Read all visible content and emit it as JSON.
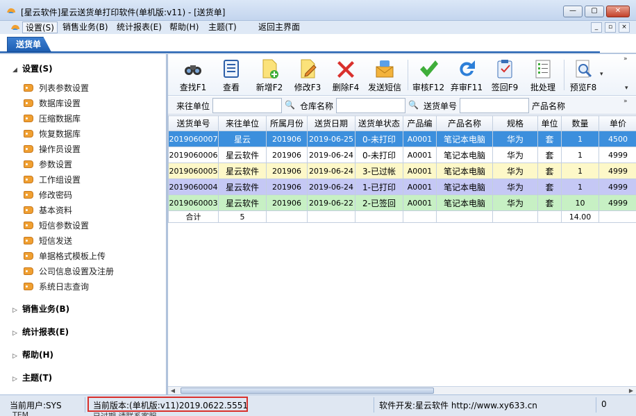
{
  "window": {
    "title": "[星云软件]星云送货单打印软件(单机版:v11) - [送货单]",
    "minimize_label": "—",
    "maximize_label": "▢",
    "close_label": "✕"
  },
  "menu": {
    "items": [
      "设置(S)",
      "销售业务(B)",
      "统计报表(E)",
      "帮助(H)",
      "主题(T)",
      "返回主界面"
    ],
    "mdi": [
      "_",
      "▫",
      "×"
    ]
  },
  "tab": {
    "label": "送货单"
  },
  "sidebar": {
    "settings_header": "设置(S)",
    "settings_items": [
      "列表参数设置",
      "数据库设置",
      "压缩数据库",
      "恢复数据库",
      "操作员设置",
      "参数设置",
      "工作组设置",
      "修改密码",
      "基本资料",
      "短信参数设置",
      "短信发送",
      "单据格式模板上传",
      "公司信息设置及注册",
      "系统日志查询"
    ],
    "sections": [
      "销售业务(B)",
      "统计报表(E)",
      "帮助(H)",
      "主题(T)"
    ]
  },
  "toolbar": {
    "buttons": [
      "查找F1",
      "查看",
      "新增F2",
      "修改F3",
      "删除F4",
      "发送短信",
      "审核F12",
      "弃审F11",
      "签回F9",
      "批处理",
      "预览F8"
    ]
  },
  "filters": {
    "customer_label": "来往单位",
    "warehouse_label": "仓库名称",
    "order_no_label": "送货单号",
    "product_label": "产品名称"
  },
  "table": {
    "columns": [
      "送货单号",
      "来往单位",
      "所属月份",
      "送货日期",
      "送货单状态",
      "产品编",
      "产品名称",
      "规格",
      "单位",
      "数量",
      "单价"
    ],
    "rows": [
      {
        "no": "2019060007",
        "customer": "星云",
        "month": "201906",
        "date": "2019-06-25",
        "status": "0-未打印",
        "code": "A0001",
        "product": "笔记本电脑",
        "spec": "华为",
        "unit": "套",
        "qty": "1",
        "price": "4500"
      },
      {
        "no": "2019060006",
        "customer": "星云软件",
        "month": "201906",
        "date": "2019-06-24",
        "status": "0-未打印",
        "code": "A0001",
        "product": "笔记本电脑",
        "spec": "华为",
        "unit": "套",
        "qty": "1",
        "price": "4999"
      },
      {
        "no": "2019060005",
        "customer": "星云软件",
        "month": "201906",
        "date": "2019-06-24",
        "status": "3-已过帐",
        "code": "A0001",
        "product": "笔记本电脑",
        "spec": "华为",
        "unit": "套",
        "qty": "1",
        "price": "4999"
      },
      {
        "no": "2019060004",
        "customer": "星云软件",
        "month": "201906",
        "date": "2019-06-24",
        "status": "1-已打印",
        "code": "A0001",
        "product": "笔记本电脑",
        "spec": "华为",
        "unit": "套",
        "qty": "1",
        "price": "4999"
      },
      {
        "no": "2019060003",
        "customer": "星云软件",
        "month": "201906",
        "date": "2019-06-22",
        "status": "2-已签回",
        "code": "A0001",
        "product": "笔记本电脑",
        "spec": "华为",
        "unit": "套",
        "qty": "10",
        "price": "4999"
      }
    ],
    "total": {
      "label": "合计",
      "count": "5",
      "qty": "14.00"
    }
  },
  "status": {
    "user": "当前用户:SYS",
    "user_cut": "TEM",
    "version": "当前版本:(单机版:v11)2019.0622.5551",
    "version_cut": "已过期  请联系客服",
    "developer": "软件开发:星云软件 http://www.xy633.cn",
    "count": "0"
  },
  "colors": {
    "selected_row": "#3c8fdd",
    "yellow_row": "#fdf8c8",
    "purple_row": "#c5c8f5",
    "green_row": "#c7f0c4",
    "highlight_box": "#d9302c"
  }
}
